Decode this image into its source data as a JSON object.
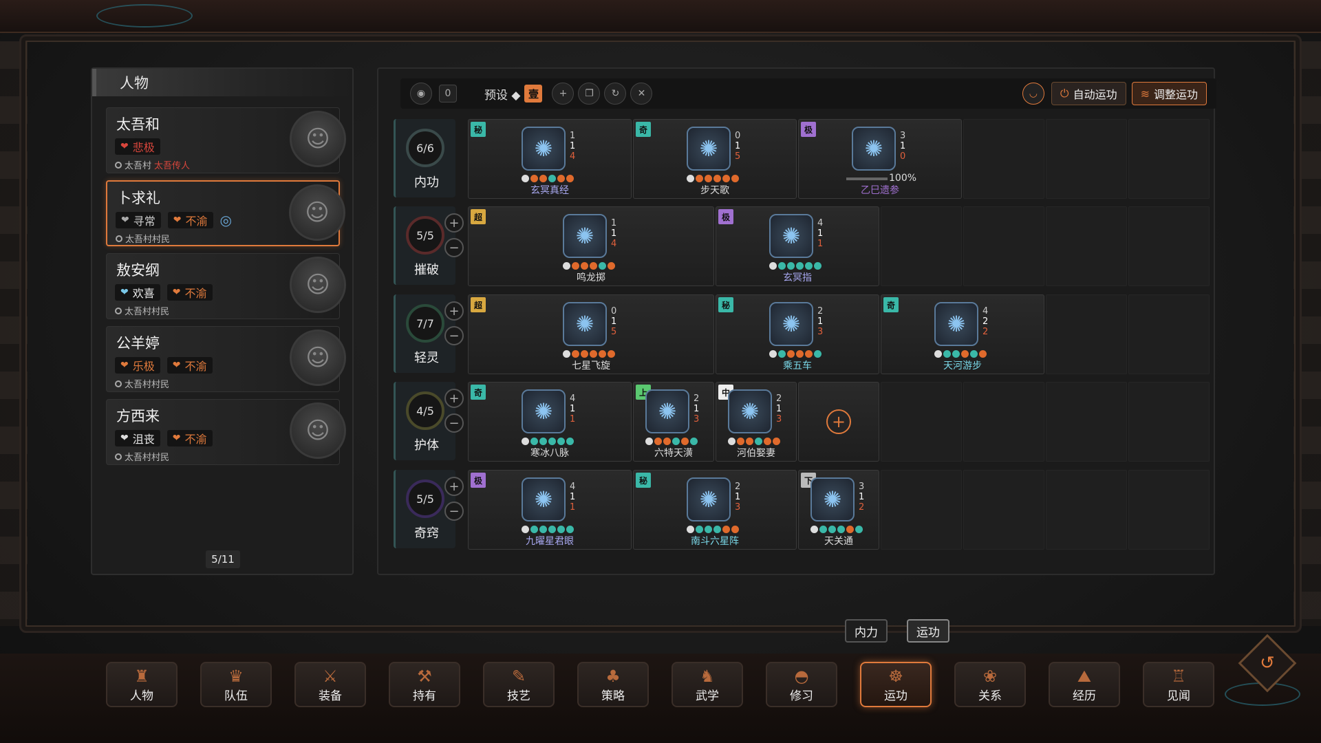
{
  "character_panel": {
    "title": "人物",
    "page": "5/11",
    "characters": [
      {
        "name": "太吾和",
        "moods": [
          {
            "label": "悲极",
            "color": "#d9463c",
            "heart": "#d9463c"
          }
        ],
        "origin_prefix": "太吾村",
        "origin_title": "太吾传人",
        "origin_color": "#d9463c",
        "selected": false
      },
      {
        "name": "卜求礼",
        "moods": [
          {
            "label": "寻常",
            "color": "#cccccc",
            "heart": "#aaaaaa"
          },
          {
            "label": "不渝",
            "color": "#e07a3c",
            "heart": "#e07a3c"
          }
        ],
        "origin_prefix": "太吾村村民",
        "origin_title": "",
        "origin_color": "#bbbbbb",
        "selected": true
      },
      {
        "name": "敖安纲",
        "moods": [
          {
            "label": "欢喜",
            "color": "#e8e8e8",
            "heart": "#7ac8e8"
          },
          {
            "label": "不渝",
            "color": "#e07a3c",
            "heart": "#e07a3c"
          }
        ],
        "origin_prefix": "太吾村村民",
        "origin_title": "",
        "origin_color": "#bbbbbb",
        "selected": false
      },
      {
        "name": "公羊婷",
        "moods": [
          {
            "label": "乐极",
            "color": "#e07a3c",
            "heart": "#e07a3c"
          },
          {
            "label": "不渝",
            "color": "#e07a3c",
            "heart": "#e07a3c"
          }
        ],
        "origin_prefix": "太吾村村民",
        "origin_title": "",
        "origin_color": "#bbbbbb",
        "selected": false
      },
      {
        "name": "方西来",
        "moods": [
          {
            "label": "沮丧",
            "color": "#e8e8e8",
            "heart": "#dddddd"
          },
          {
            "label": "不渝",
            "color": "#e07a3c",
            "heart": "#e07a3c"
          }
        ],
        "origin_prefix": "太吾村村民",
        "origin_title": "",
        "origin_color": "#bbbbbb",
        "selected": false
      }
    ]
  },
  "toolbar": {
    "count": "0",
    "preset_label": "预设 ◆",
    "preset_value": "壹",
    "auto_label": "自动运功",
    "adjust_label": "调整运功"
  },
  "rows": [
    {
      "name": "内功",
      "count": "6/6",
      "ring_color": "#3a4a4a",
      "has_pm": false,
      "slots": [
        {
          "span": 1,
          "tier": "秘",
          "tier_color": "#3ab8a8",
          "name": "玄冥真经",
          "name_color": "#a8a8f0",
          "nums": [
            "1",
            "1",
            "4"
          ],
          "dots": [
            "#ddd",
            "#e06a2c",
            "#e06a2c",
            "#3ab8a8",
            "#e06a2c",
            "#e06a2c"
          ]
        },
        {
          "span": 1,
          "tier": "奇",
          "tier_color": "#3ab8a8",
          "name": "步天歌",
          "name_color": "#dddddd",
          "nums": [
            "0",
            "1",
            "5"
          ],
          "dots": [
            "#ddd",
            "#e06a2c",
            "#e06a2c",
            "#e06a2c",
            "#e06a2c",
            "#e06a2c"
          ]
        },
        {
          "span": 1,
          "tier": "极",
          "tier_color": "#a070d0",
          "name": "乙巳遗参",
          "name_color": "#a070d0",
          "nums": [
            "3",
            "1",
            "0"
          ],
          "progress": "100%"
        }
      ]
    },
    {
      "name": "摧破",
      "count": "5/5",
      "ring_color": "#5a2a2a",
      "has_pm": true,
      "slots": [
        {
          "span": 1.5,
          "tier": "超",
          "tier_color": "#d8a840",
          "name": "鸣龙掷",
          "name_color": "#dddddd",
          "nums": [
            "1",
            "1",
            "4"
          ],
          "dots": [
            "#ddd",
            "#e06a2c",
            "#e06a2c",
            "#e06a2c",
            "#3ab8a8",
            "#e06a2c"
          ]
        },
        {
          "span": 1,
          "tier": "极",
          "tier_color": "#a070d0",
          "name": "玄冥指",
          "name_color": "#a8a8f0",
          "nums": [
            "4",
            "1",
            "1"
          ],
          "dots": [
            "#ddd",
            "#3ab8a8",
            "#3ab8a8",
            "#3ab8a8",
            "#3ab8a8",
            "#3ab8a8"
          ]
        }
      ]
    },
    {
      "name": "轻灵",
      "count": "7/7",
      "ring_color": "#2a4a3a",
      "has_pm": true,
      "slots": [
        {
          "span": 1.5,
          "tier": "超",
          "tier_color": "#d8a840",
          "name": "七星飞旋",
          "name_color": "#dddddd",
          "nums": [
            "0",
            "1",
            "5"
          ],
          "dots": [
            "#ddd",
            "#e06a2c",
            "#e06a2c",
            "#e06a2c",
            "#e06a2c",
            "#e06a2c"
          ]
        },
        {
          "span": 1,
          "tier": "秘",
          "tier_color": "#3ab8a8",
          "name": "乘五车",
          "name_color": "#7ad8e8",
          "nums": [
            "2",
            "1",
            "3"
          ],
          "dots": [
            "#ddd",
            "#3ab8a8",
            "#e06a2c",
            "#e06a2c",
            "#e06a2c",
            "#3ab8a8"
          ]
        },
        {
          "span": 1,
          "tier": "奇",
          "tier_color": "#3ab8a8",
          "name": "天河游步",
          "name_color": "#7ad8e8",
          "nums": [
            "4",
            "2",
            "2"
          ],
          "dots": [
            "#ddd",
            "#3ab8a8",
            "#3ab8a8",
            "#e06a2c",
            "#3ab8a8",
            "#e06a2c"
          ]
        }
      ]
    },
    {
      "name": "护体",
      "count": "4/5",
      "ring_color": "#4a4a2a",
      "has_pm": true,
      "slots": [
        {
          "span": 1,
          "tier": "奇",
          "tier_color": "#3ab8a8",
          "name": "寒冰八脉",
          "name_color": "#dddddd",
          "nums": [
            "4",
            "1",
            "1"
          ],
          "dots": [
            "#ddd",
            "#3ab8a8",
            "#3ab8a8",
            "#3ab8a8",
            "#3ab8a8",
            "#3ab8a8"
          ]
        },
        {
          "span": 0.5,
          "tier": "上",
          "tier_color": "#5ac870",
          "name": "六特天潢",
          "name_color": "#dddddd",
          "nums": [
            "2",
            "1",
            "3"
          ],
          "dots": [
            "#ddd",
            "#e06a2c",
            "#e06a2c",
            "#3ab8a8",
            "#e06a2c",
            "#3ab8a8"
          ]
        },
        {
          "span": 0.5,
          "tier": "中",
          "tier_color": "#eeeeee",
          "name": "河伯娶妻",
          "name_color": "#dddddd",
          "nums": [
            "2",
            "1",
            "3"
          ],
          "dots": [
            "#ddd",
            "#e06a2c",
            "#e06a2c",
            "#3ab8a8",
            "#e06a2c",
            "#e06a2c"
          ]
        },
        {
          "span": 0.5,
          "add": true
        }
      ]
    },
    {
      "name": "奇窍",
      "count": "5/5",
      "ring_color": "#3a2a5a",
      "has_pm": true,
      "slots": [
        {
          "span": 1,
          "tier": "极",
          "tier_color": "#a070d0",
          "name": "九曜星君眼",
          "name_color": "#a8a8f0",
          "nums": [
            "4",
            "1",
            "1"
          ],
          "dots": [
            "#ddd",
            "#3ab8a8",
            "#3ab8a8",
            "#3ab8a8",
            "#3ab8a8",
            "#3ab8a8"
          ]
        },
        {
          "span": 1,
          "tier": "秘",
          "tier_color": "#3ab8a8",
          "name": "南斗六星阵",
          "name_color": "#7ad8e8",
          "nums": [
            "2",
            "1",
            "3"
          ],
          "dots": [
            "#ddd",
            "#3ab8a8",
            "#3ab8a8",
            "#3ab8a8",
            "#e06a2c",
            "#e06a2c"
          ]
        },
        {
          "span": 0.5,
          "tier": "下",
          "tier_color": "#bbbbbb",
          "name": "天关通",
          "name_color": "#dddddd",
          "nums": [
            "3",
            "1",
            "2"
          ],
          "dots": [
            "#ddd",
            "#3ab8a8",
            "#3ab8a8",
            "#3ab8a8",
            "#e06a2c",
            "#3ab8a8"
          ]
        }
      ]
    }
  ],
  "sub_tabs": [
    {
      "label": "内力",
      "selected": false
    },
    {
      "label": "运功",
      "selected": true
    }
  ],
  "nav": [
    {
      "label": "人物",
      "icon": "person-icon",
      "glyph": "♜"
    },
    {
      "label": "队伍",
      "icon": "team-icon",
      "glyph": "♛"
    },
    {
      "label": "装备",
      "icon": "equipment-icon",
      "glyph": "⚔"
    },
    {
      "label": "持有",
      "icon": "inventory-icon",
      "glyph": "⚒"
    },
    {
      "label": "技艺",
      "icon": "craft-icon",
      "glyph": "✎"
    },
    {
      "label": "策略",
      "icon": "strategy-icon",
      "glyph": "♣"
    },
    {
      "label": "武学",
      "icon": "martial-icon",
      "glyph": "♞"
    },
    {
      "label": "修习",
      "icon": "practice-icon",
      "glyph": "◓"
    },
    {
      "label": "运功",
      "icon": "qi-icon",
      "glyph": "☸"
    },
    {
      "label": "关系",
      "icon": "relation-icon",
      "glyph": "❀"
    },
    {
      "label": "经历",
      "icon": "history-icon",
      "glyph": "⛰"
    },
    {
      "label": "见闻",
      "icon": "knowledge-icon",
      "glyph": "♖"
    }
  ],
  "selected_nav": "运功"
}
